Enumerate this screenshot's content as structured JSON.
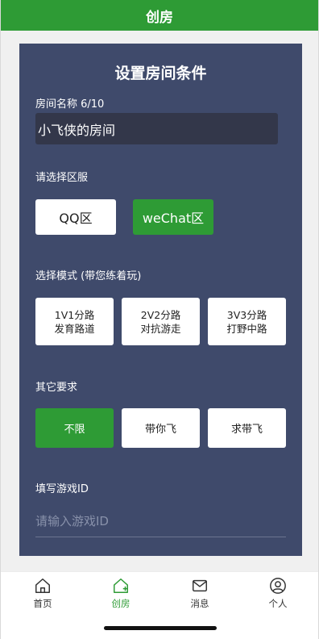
{
  "header": {
    "title": "创房"
  },
  "panel": {
    "title": "设置房间条件",
    "room_name_label": "房间名称 6/10",
    "room_name_value": "小飞侠的房间",
    "region_label": "请选择区服",
    "regions": [
      {
        "label": "QQ区",
        "active": false
      },
      {
        "label": "weChat区",
        "active": true
      }
    ],
    "mode_label": "选择模式 (带您练着玩)",
    "modes": [
      {
        "line1": "1V1分路",
        "line2": "发育路道"
      },
      {
        "line1": "2V2分路",
        "line2": "对抗游走"
      },
      {
        "line1": "3V3分路",
        "line2": "打野中路"
      }
    ],
    "requirements_label": "其它要求",
    "requirements": [
      {
        "label": "不限",
        "active": true
      },
      {
        "label": "带你飞",
        "active": false
      },
      {
        "label": "求带飞",
        "active": false
      }
    ],
    "game_id_label": "填写游戏ID",
    "game_id_placeholder": "请输入游戏ID"
  },
  "tabbar": {
    "items": [
      {
        "label": "首页",
        "icon": "home-icon",
        "active": false
      },
      {
        "label": "创房",
        "icon": "create-room-icon",
        "active": true
      },
      {
        "label": "消息",
        "icon": "mail-icon",
        "active": false
      },
      {
        "label": "个人",
        "icon": "person-icon",
        "active": false
      }
    ]
  },
  "colors": {
    "accent": "#2e9b35",
    "panel": "#3f4a6b",
    "input_bg": "#33374a"
  }
}
